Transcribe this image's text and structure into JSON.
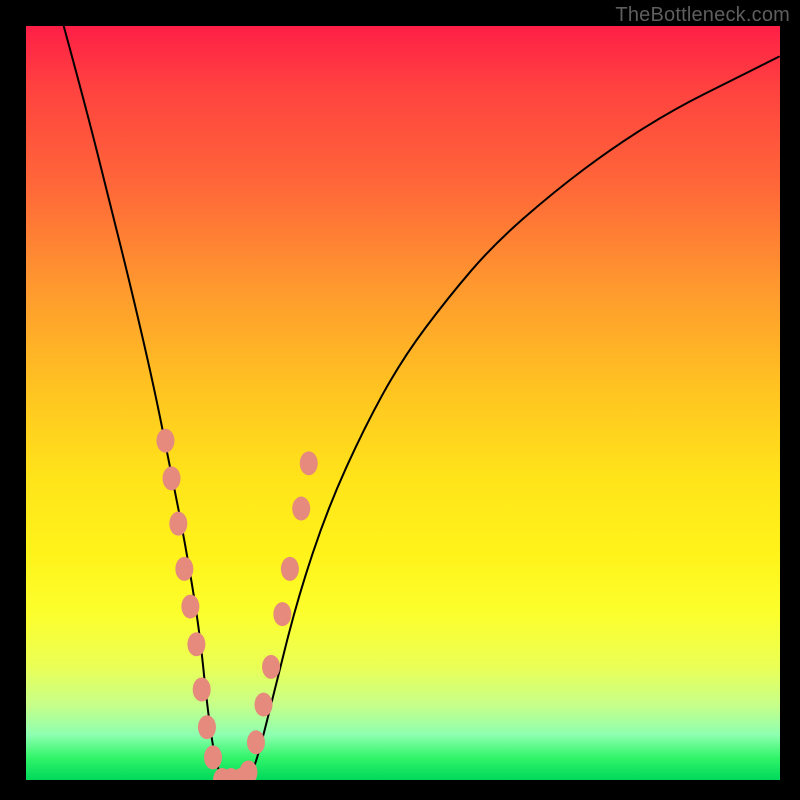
{
  "watermark": "TheBottleneck.com",
  "chart_data": {
    "type": "line",
    "title": "",
    "xlabel": "",
    "ylabel": "",
    "xlim": [
      0,
      100
    ],
    "ylim": [
      0,
      100
    ],
    "legend": false,
    "grid": false,
    "curve": {
      "description": "V-shaped bottleneck curve; y is perceived mismatch percentage (0 = perfect match at green bottom, 100 = worst at red top); valley floor ≈ 0 between x≈25 and x≈30",
      "x": [
        5,
        8,
        11,
        14,
        17,
        19,
        21,
        23,
        24,
        25,
        26,
        27,
        28,
        29,
        30,
        31,
        33,
        36,
        40,
        45,
        50,
        56,
        62,
        70,
        78,
        86,
        94,
        100
      ],
      "y": [
        100,
        89,
        77,
        65,
        52,
        42,
        32,
        20,
        10,
        3,
        0,
        0,
        0,
        0,
        1,
        4,
        12,
        24,
        36,
        47,
        56,
        64,
        71,
        78,
        84,
        89,
        93,
        96
      ]
    },
    "markers": {
      "description": "salmon-colored sample dots along the lower walls and floor of the V",
      "color": "#e58a7d",
      "points": [
        {
          "x": 18.5,
          "y": 45
        },
        {
          "x": 19.3,
          "y": 40
        },
        {
          "x": 20.2,
          "y": 34
        },
        {
          "x": 21.0,
          "y": 28
        },
        {
          "x": 21.8,
          "y": 23
        },
        {
          "x": 22.6,
          "y": 18
        },
        {
          "x": 23.3,
          "y": 12
        },
        {
          "x": 24.0,
          "y": 7
        },
        {
          "x": 24.8,
          "y": 3
        },
        {
          "x": 26.0,
          "y": 0
        },
        {
          "x": 27.2,
          "y": 0
        },
        {
          "x": 28.5,
          "y": 0
        },
        {
          "x": 29.5,
          "y": 1
        },
        {
          "x": 30.5,
          "y": 5
        },
        {
          "x": 31.5,
          "y": 10
        },
        {
          "x": 32.5,
          "y": 15
        },
        {
          "x": 34.0,
          "y": 22
        },
        {
          "x": 35.0,
          "y": 28
        },
        {
          "x": 36.5,
          "y": 36
        },
        {
          "x": 37.5,
          "y": 42
        }
      ]
    }
  }
}
